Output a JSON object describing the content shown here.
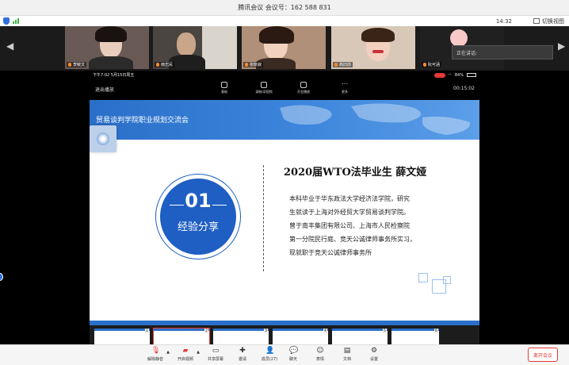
{
  "window": {
    "title": "腾讯会议  会议号：162 588 831"
  },
  "status": {
    "time": "14:32",
    "view_switch": "切换视图"
  },
  "participants": [
    {
      "name": "李敏文",
      "bg": "#6a5a55"
    },
    {
      "name": "雨志民",
      "bg": "#4a4540"
    },
    {
      "name": "张晓寂",
      "bg": "#b09078"
    },
    {
      "name": "高旧前",
      "bg": "#d8c8b8"
    },
    {
      "name": "阮可涵",
      "bg": "#202020"
    }
  ],
  "speaking_label": "正在讲话:",
  "phone": {
    "status_left": "下午7:02  5月15日周五",
    "battery": "84%",
    "exit_label": "退出播放",
    "tools": [
      "基础",
      "录制/读视频",
      "开会播放",
      "更多"
    ],
    "timer": "00:15:02"
  },
  "slide": {
    "header_title": "贸易谈判学院职业规划交流会",
    "circle_number": "01",
    "circle_label": "经验分享",
    "bio_title": "2020届WTO法毕业生 薛文娅",
    "bio_lines": [
      "本科毕业于华东政法大学经济法学院，研究",
      "生就读于上海对外经贸大学贸易谈判学院。",
      "曾于南丰集团有限公司、上海市人民检察院",
      "第一分院民行庭、竞天公诚律师事务所实习，",
      "现就职于竞天公诚律师事务所"
    ]
  },
  "thumbnails": [
    "1",
    "2",
    "3",
    "4",
    "5",
    "6"
  ],
  "toolbar": {
    "mute": "解除静音",
    "video": "开启视频",
    "share": "共享屏幕",
    "invite": "邀请",
    "members": "成员(27)",
    "chat": "聊天",
    "reaction": "表情",
    "docs": "文档",
    "settings": "设置",
    "leave": "离开会议"
  },
  "colors": {
    "accent": "#1f5fc4",
    "leave": "#e53935"
  }
}
